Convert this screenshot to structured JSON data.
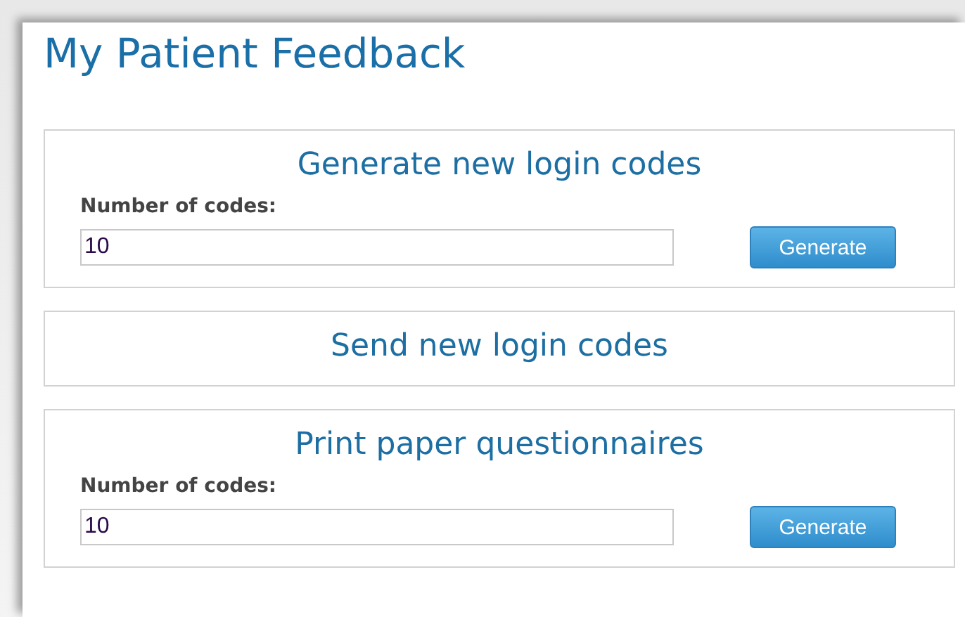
{
  "page": {
    "title": "My Patient Feedback"
  },
  "sections": [
    {
      "kind": "form",
      "heading": "Generate new login codes",
      "label": "Number of codes:",
      "value": "10",
      "button": "Generate"
    },
    {
      "kind": "header",
      "heading": "Send new login codes"
    },
    {
      "kind": "form",
      "heading": "Print paper questionnaires",
      "label": "Number of codes:",
      "value": "10",
      "button": "Generate"
    }
  ]
}
